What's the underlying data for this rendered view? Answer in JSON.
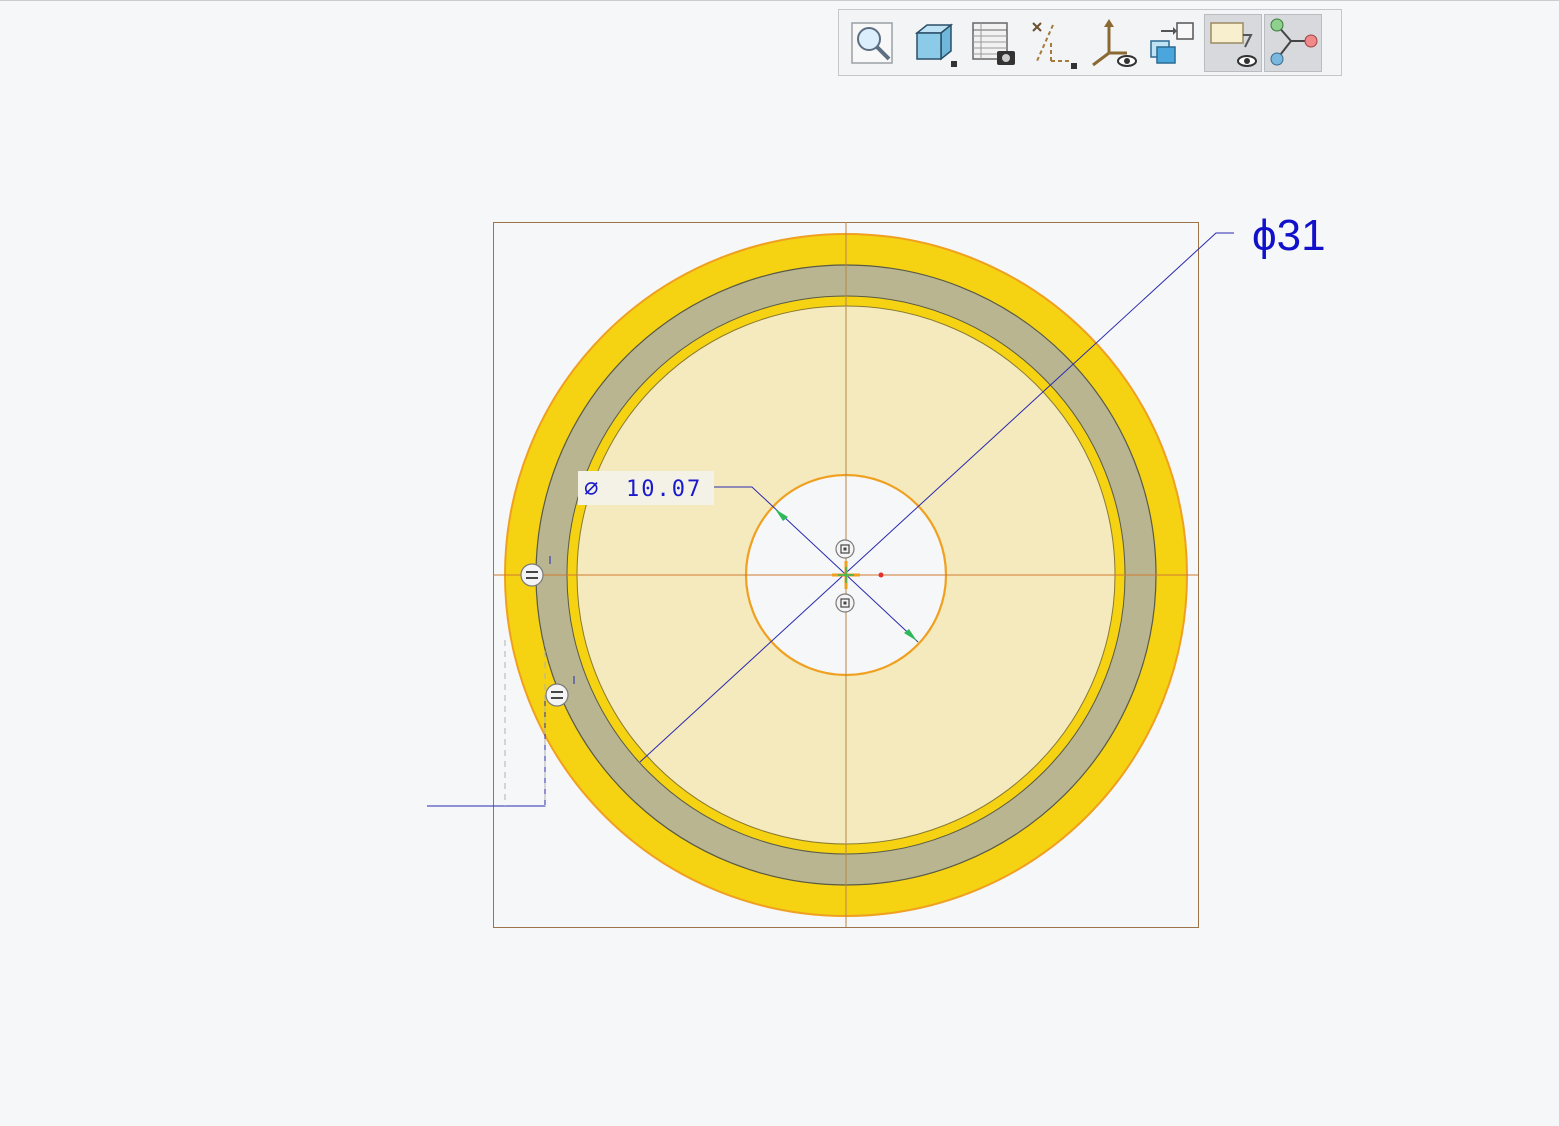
{
  "toolbar": {
    "items": [
      {
        "name": "zoom-to-fit",
        "icon": "magnifier-icon",
        "active": false
      },
      {
        "name": "display-style",
        "icon": "cube-icon",
        "active": false
      },
      {
        "name": "saved-views",
        "icon": "table-camera-icon",
        "active": false
      },
      {
        "name": "datum-display",
        "icon": "datum-axes-icon",
        "active": false
      },
      {
        "name": "csys-display",
        "icon": "coordinate-eye-icon",
        "active": false
      },
      {
        "name": "view-manager",
        "icon": "layered-views-icon",
        "active": false
      },
      {
        "name": "annotation-display",
        "icon": "annotation-eye-icon",
        "active": true
      },
      {
        "name": "sketcher-display",
        "icon": "constraint-nodes-icon",
        "active": true
      }
    ]
  },
  "dimensions": {
    "outer_diameter": "ϕ31",
    "inner_diameter_symbol": "∅",
    "inner_diameter_value": "10.07"
  },
  "colors": {
    "background": "#f6f7f8",
    "outer_ring": "#f5d313",
    "gray_ring": "#b8b590",
    "face_fill": "#f5eabd",
    "edge_orange": "#f0a020",
    "centerline": "#c87a2e",
    "dimension_blue": "#1a1acc",
    "arrow_green": "#2fb85a"
  }
}
